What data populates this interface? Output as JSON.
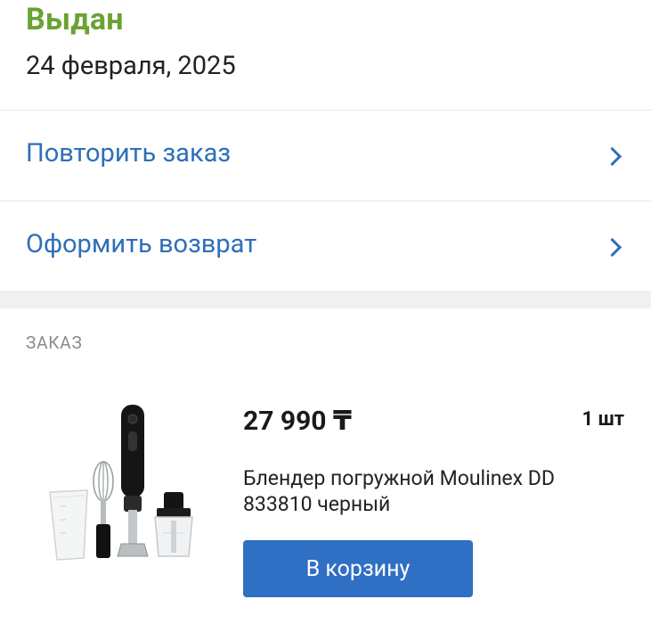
{
  "status": {
    "title": "Выдан",
    "date": "24 февраля, 2025",
    "color": "#6aa334"
  },
  "actions": [
    {
      "label": "Повторить заказ",
      "icon": "chevron-right-icon"
    },
    {
      "label": "Оформить возврат",
      "icon": "chevron-right-icon"
    }
  ],
  "order": {
    "section_label": "ЗАКАЗ",
    "item": {
      "price": "27 990 ₸",
      "quantity": "1 шт",
      "name": "Блендер погружной Moulinex DD 833810 черный",
      "image": "blender-product-image"
    },
    "cart_button_label": "В корзину"
  },
  "colors": {
    "accent": "#2f6fb8",
    "button": "#2f6fc4",
    "status_green": "#6aa334"
  }
}
